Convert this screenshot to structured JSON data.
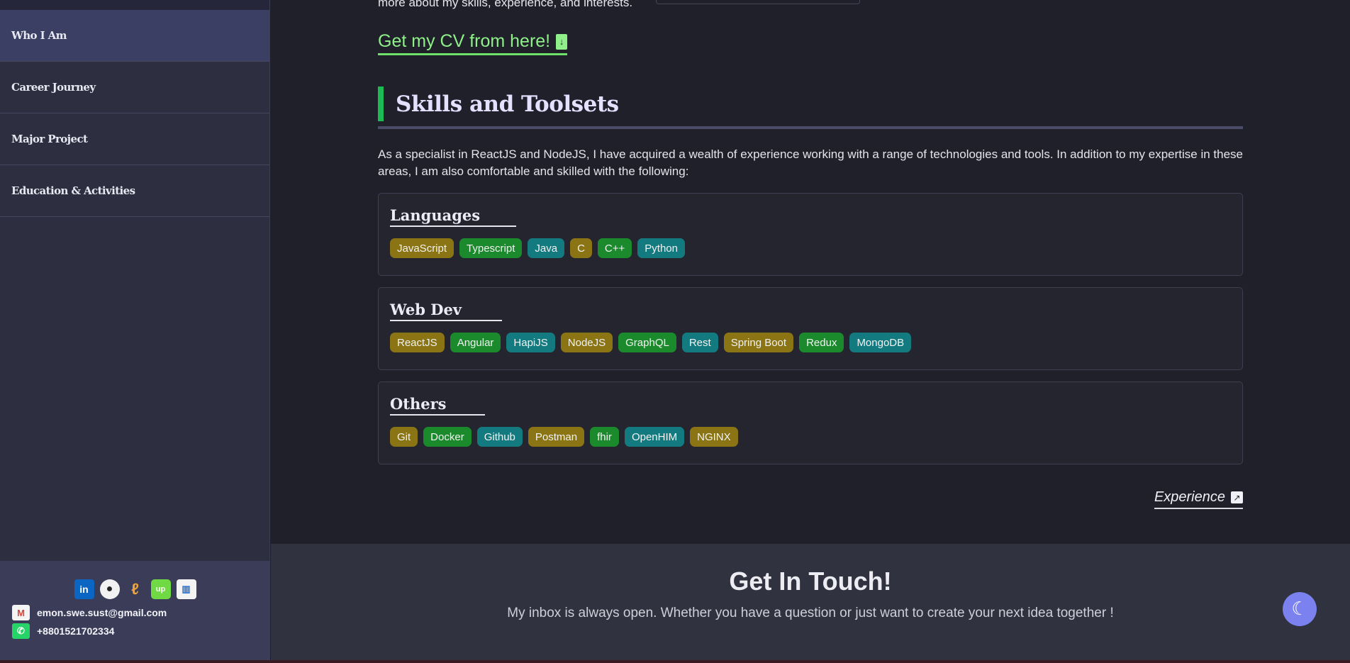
{
  "sidebar": {
    "items": [
      {
        "label": "Who I Am"
      },
      {
        "label": "Career Journey"
      },
      {
        "label": "Major Project"
      },
      {
        "label": "Education & Activities"
      }
    ],
    "social_icons": [
      "linkedin-icon",
      "github-icon",
      "leetcode-icon",
      "upwork-icon",
      "chart-icon"
    ],
    "email": "emon.swe.sust@gmail.com",
    "phone": "+8801521702334"
  },
  "main": {
    "top_fragment": "more about my skills, experience, and interests.",
    "cv_link": "Get my CV from here!",
    "section_title": "Skills and Toolsets",
    "intro": "As a specialist in ReactJS and NodeJS, I have acquired a wealth of experience working with a range of technologies and tools. In addition to my expertise in these areas, I am also comfortable and skilled with the following:",
    "cards": [
      {
        "title": "Languages",
        "tags": [
          "JavaScript",
          "Typescript",
          "Java",
          "C",
          "C++",
          "Python"
        ]
      },
      {
        "title": "Web Dev",
        "tags": [
          "ReactJS",
          "Angular",
          "HapiJS",
          "NodeJS",
          "GraphQL",
          "Rest",
          "Spring Boot",
          "Redux",
          "MongoDB"
        ]
      },
      {
        "title": "Others",
        "tags": [
          "Git",
          "Docker",
          "Github",
          "Postman",
          "fhir",
          "OpenHIM",
          "NGINX"
        ]
      }
    ],
    "experience_link": "Experience"
  },
  "contact": {
    "title": "Get In Touch!",
    "subtitle": "My inbox is always open. Whether you have a question or just want to create your next idea together !"
  },
  "colors": {
    "accent_green": "#8ff08a",
    "section_bar": "#1db954",
    "tag_gold": "#8a7414",
    "tag_green": "#1b8a2c",
    "tag_teal": "#137b80",
    "toggle": "#7b82f0"
  }
}
